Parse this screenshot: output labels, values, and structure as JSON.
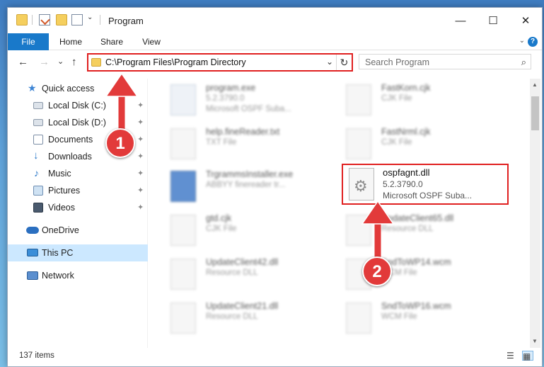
{
  "window": {
    "title": "Program",
    "controls": {
      "minimize": "—",
      "maximize": "☐",
      "close": "✕"
    }
  },
  "ribbon": {
    "tabs": [
      "File",
      "Home",
      "Share",
      "View"
    ],
    "collapse": "⌄",
    "help": "?"
  },
  "navigation": {
    "back": "←",
    "forward": "→",
    "recent": "⌄",
    "up": "↑",
    "address": "C:\\Program Files\\Program Directory",
    "dropdown": "⌄",
    "refresh": "↻",
    "search_placeholder": "Search Program",
    "search_icon": "⌕"
  },
  "sidebar": {
    "items": [
      {
        "label": "Quick access",
        "icon": "star-icon",
        "pinned": false
      },
      {
        "label": "Local Disk (C:)",
        "icon": "drive-icon",
        "pinned": true
      },
      {
        "label": "Local Disk (D:)",
        "icon": "drive-icon",
        "pinned": true
      },
      {
        "label": "Documents",
        "icon": "documents-icon",
        "pinned": true
      },
      {
        "label": "Downloads",
        "icon": "download-icon",
        "pinned": true
      },
      {
        "label": "Music",
        "icon": "music-icon",
        "pinned": true
      },
      {
        "label": "Pictures",
        "icon": "pictures-icon",
        "pinned": true
      },
      {
        "label": "Videos",
        "icon": "videos-icon",
        "pinned": true
      },
      {
        "label": "OneDrive",
        "icon": "cloud-icon",
        "pinned": false
      },
      {
        "label": "This PC",
        "icon": "computer-icon",
        "pinned": false,
        "selected": true
      },
      {
        "label": "Network",
        "icon": "network-icon",
        "pinned": false
      }
    ],
    "pin_glyph": "📌"
  },
  "files": [
    {
      "name": "program.exe",
      "version": "5.2.3790.0",
      "desc": "Microsoft OSPF Suba..."
    },
    {
      "name": "FastKorn.cjk",
      "version": "CJK File",
      "desc": ""
    },
    {
      "name": "help.fineReader.txt",
      "version": "TXT File",
      "desc": ""
    },
    {
      "name": "FastNrml.cjk",
      "version": "CJK File",
      "desc": ""
    },
    {
      "name": "TrgrammsInstaller.exe",
      "version": "ABBYY finereader tr...",
      "desc": ""
    },
    {
      "name": "gtd.cjk",
      "version": "CJK File",
      "desc": ""
    },
    {
      "name": "UpdateClient65.dll",
      "version": "Resource DLL",
      "desc": ""
    },
    {
      "name": "UpdateClient42.dll",
      "version": "Resource DLL",
      "desc": ""
    },
    {
      "name": "SndToWP14.wcm",
      "version": "WCM File",
      "desc": ""
    },
    {
      "name": "UpdateClient21.dll",
      "version": "Resource DLL",
      "desc": ""
    },
    {
      "name": "SndToWP16.wcm",
      "version": "WCM File",
      "desc": ""
    }
  ],
  "highlighted_file": {
    "name": "ospfagnt.dll",
    "version": "5.2.3790.0",
    "desc": "Microsoft OSPF Suba..."
  },
  "status": {
    "items": "137 items"
  },
  "annotations": {
    "step1": "1",
    "step2": "2"
  },
  "colors": {
    "accent": "#1979ca",
    "annotation": "#e02020",
    "selected": "#cce8ff"
  }
}
